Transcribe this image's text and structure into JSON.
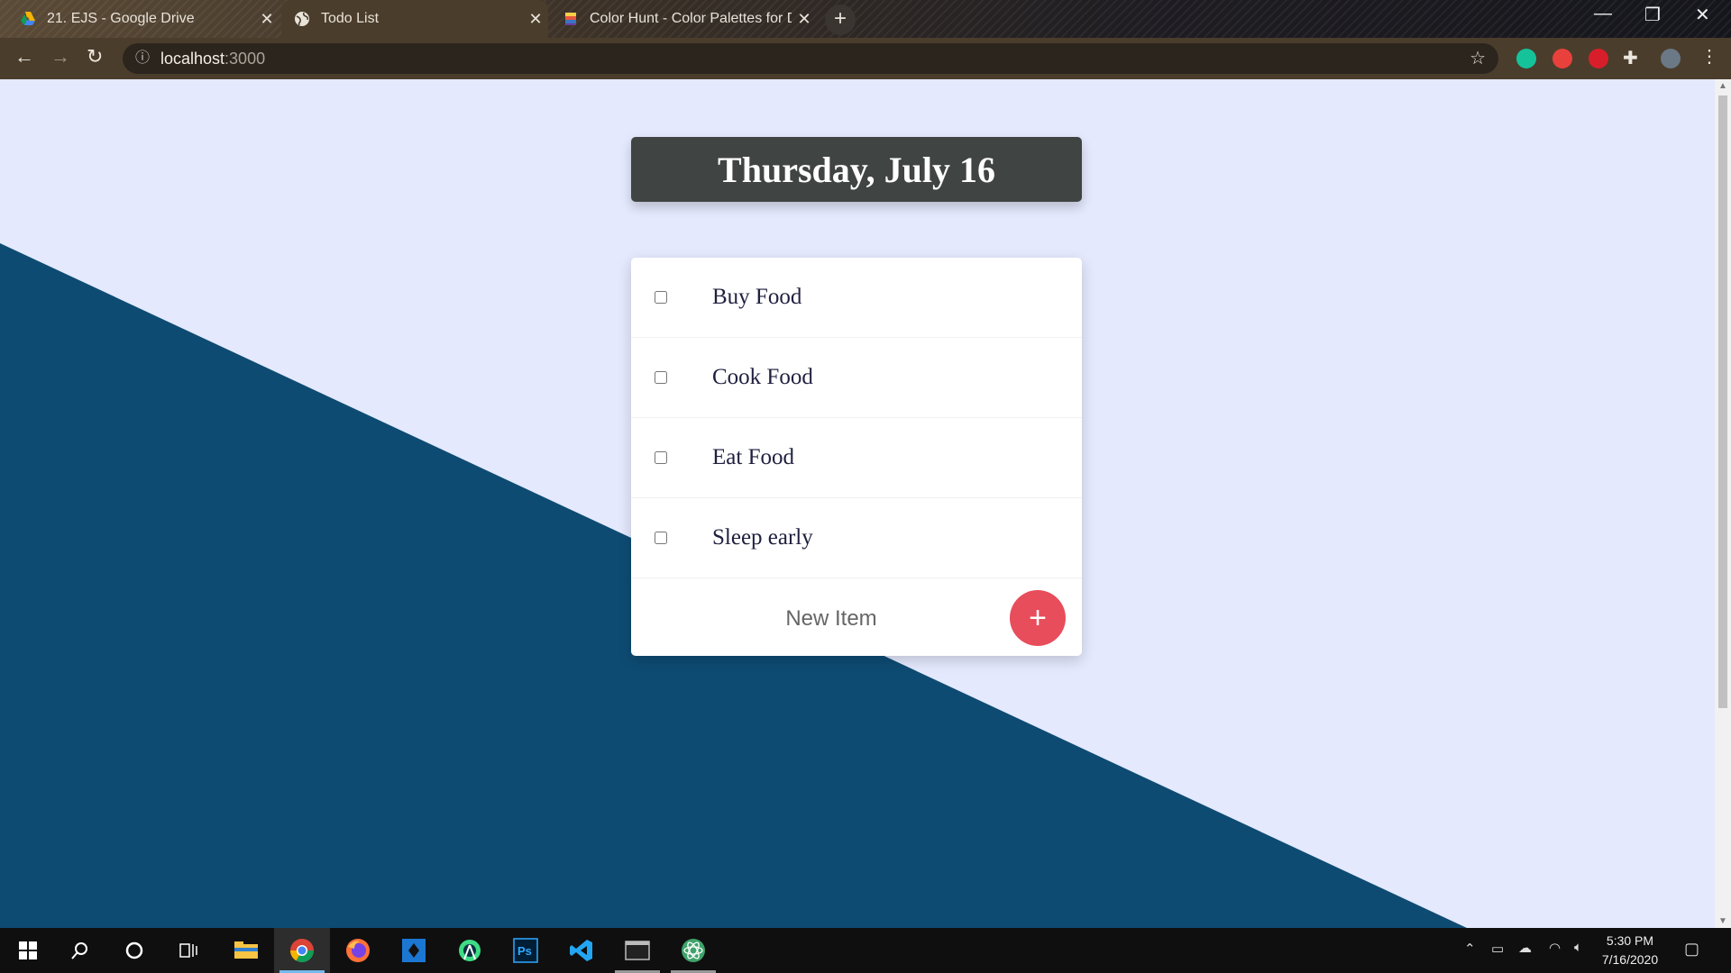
{
  "browser": {
    "tabs": [
      {
        "title": "21. EJS - Google Drive",
        "icon": "google-drive-icon",
        "active": false
      },
      {
        "title": "Todo List",
        "icon": "globe-icon",
        "active": true
      },
      {
        "title": "Color Hunt - Color Palettes for D",
        "icon": "color-hunt-icon",
        "active": false
      }
    ],
    "new_tab_label": "+",
    "url_host": "localhost",
    "url_port": ":3000",
    "extensions": [
      "grammarly-icon",
      "extension-red-icon",
      "extension-sync-icon",
      "puzzle-icon",
      "profile-avatar"
    ]
  },
  "page": {
    "background_color": "#e4e9fd",
    "accent_color": "#0e4b73",
    "heading": "Thursday, July 16",
    "items": [
      {
        "label": "Buy Food",
        "checked": false
      },
      {
        "label": "Cook Food",
        "checked": false
      },
      {
        "label": "Eat Food",
        "checked": false
      },
      {
        "label": "Sleep early",
        "checked": false
      }
    ],
    "new_item_placeholder": "New Item",
    "add_button_label": "+",
    "add_button_color": "#e84d5b"
  },
  "taskbar": {
    "apps": [
      "windows-start-icon",
      "search-icon",
      "cortana-icon",
      "task-view-icon",
      "file-explorer-icon",
      "chrome-icon",
      "firefox-icon",
      "app-blue-icon",
      "android-studio-icon",
      "photoshop-icon",
      "vscode-icon",
      "terminal-icon",
      "atom-icon"
    ],
    "time": "5:30 PM",
    "date": "7/16/2020"
  }
}
